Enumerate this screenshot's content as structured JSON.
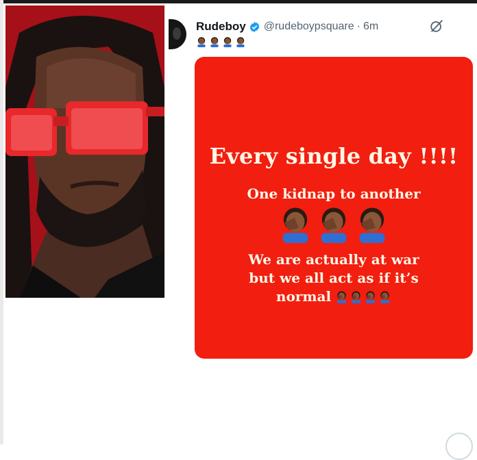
{
  "tweet": {
    "author_name": "Rudeboy",
    "handle": "@rudeboypsquare",
    "separator": "·",
    "time": "6m",
    "emoji_icons": [
      "facepalm-icon",
      "facepalm-icon",
      "facepalm-icon",
      "facepalm-icon"
    ]
  },
  "card": {
    "background_color": "#f21e10",
    "headline": "Every single day !!!!",
    "line2": "One kidnap to another",
    "line3a": "We are actually at war",
    "line3b": "but we all act as if it’s",
    "line3c": "normal"
  },
  "colors": {
    "verified": "#1d9bf0",
    "photo_background": "#b3121c",
    "sunglasses": "#e8282b"
  }
}
